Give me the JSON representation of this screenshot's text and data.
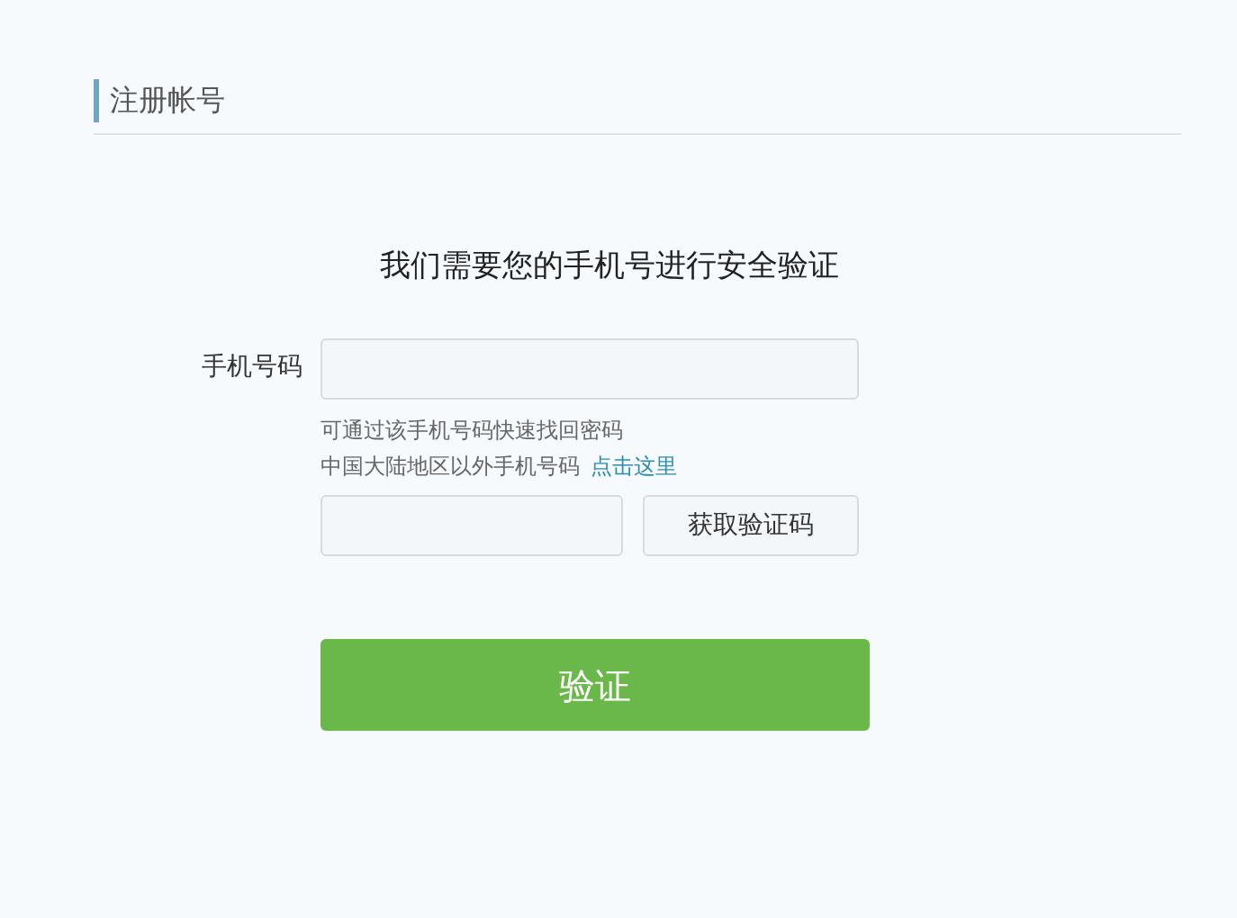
{
  "header": {
    "title": "注册帐号"
  },
  "heading": "我们需要您的手机号进行安全验证",
  "phone": {
    "label": "手机号码"
  },
  "hints": [
    "可通过该手机号码快速找回密码",
    "中国大陆地区以外手机号码"
  ],
  "hint_link": "点击这里",
  "get_code_button": "获取验证码",
  "submit_button": "验证"
}
